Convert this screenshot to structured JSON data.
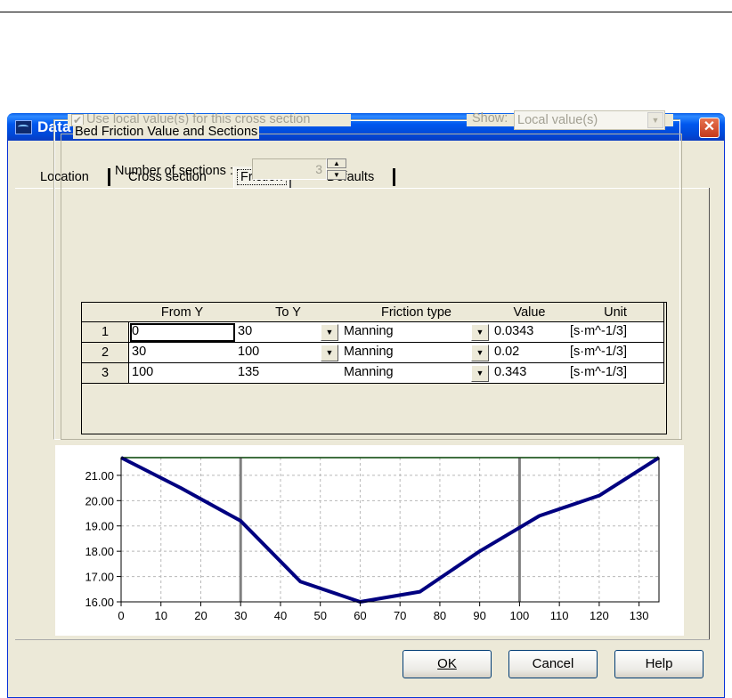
{
  "window": {
    "title": "Data Edit for Node 3",
    "close_glyph": "✕"
  },
  "tabs": [
    {
      "label": "Location"
    },
    {
      "label": "Cross section"
    },
    {
      "label": "Friction"
    },
    {
      "label": "Defaults"
    }
  ],
  "active_tab": "Friction",
  "use_local": {
    "label": "Use local value(s) for this cross section",
    "checked": true,
    "enabled": false
  },
  "show": {
    "label": "Show:",
    "value": "Local value(s)"
  },
  "bed_group": {
    "title": "Bed Friction Value and Sections"
  },
  "sections": {
    "label": "Number of sections :",
    "value": "3"
  },
  "table": {
    "columns": [
      "",
      "From Y",
      "To Y",
      "Friction type",
      "Value",
      "Unit"
    ],
    "rows": [
      {
        "n": "1",
        "from": "0",
        "to": "30",
        "type": "Manning",
        "value": "0.0343",
        "unit": "[s·m^-1/3]"
      },
      {
        "n": "2",
        "from": "30",
        "to": "100",
        "type": "Manning",
        "value": "0.02",
        "unit": "[s·m^-1/3]"
      },
      {
        "n": "3",
        "from": "100",
        "to": "135",
        "type": "Manning",
        "value": "0.343",
        "unit": "[s·m^-1/3]"
      }
    ]
  },
  "chart_data": {
    "type": "line",
    "x": [
      0,
      15,
      30,
      45,
      60,
      75,
      90,
      105,
      120,
      135
    ],
    "y": [
      21.7,
      20.5,
      19.2,
      16.8,
      16.0,
      16.4,
      18.0,
      19.4,
      20.2,
      21.7
    ],
    "xlim": [
      0,
      135
    ],
    "ylim": [
      16.0,
      21.7
    ],
    "xticks": [
      "0",
      "10",
      "20",
      "30",
      "40",
      "50",
      "60",
      "70",
      "80",
      "90",
      "100",
      "110",
      "120",
      "130"
    ],
    "yticks": [
      "16.00",
      "17.00",
      "18.00",
      "19.00",
      "20.00",
      "21.00"
    ],
    "section_boundaries": [
      30,
      100
    ],
    "water_level": 21.7,
    "grid": true,
    "colors": {
      "profile": "#000080",
      "boundary": "#808080",
      "water": "#00c000"
    }
  },
  "buttons": {
    "ok": "OK",
    "cancel": "Cancel",
    "help": "Help"
  }
}
